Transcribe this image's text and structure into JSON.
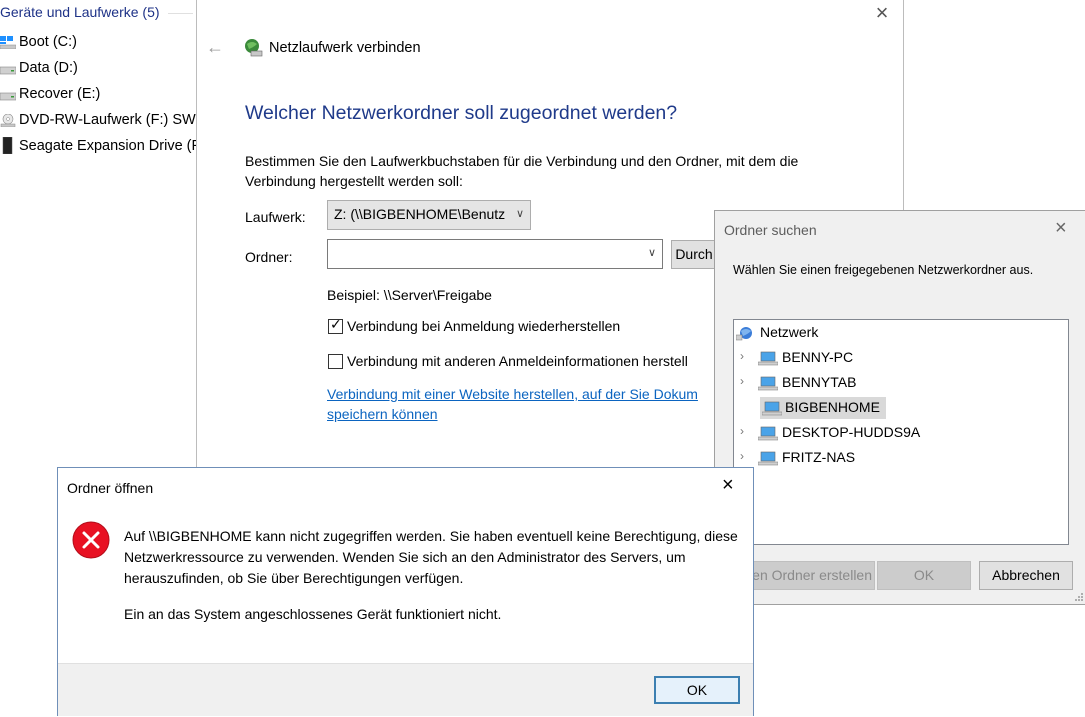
{
  "explorer": {
    "group_title": "Geräte und Laufwerke (5)",
    "drives": [
      {
        "label": "Boot (C:)",
        "icon": "windows-drive-icon"
      },
      {
        "label": "Data (D:)",
        "icon": "drive-icon"
      },
      {
        "label": "Recover (E:)",
        "icon": "drive-icon"
      },
      {
        "label": "DVD-RW-Laufwerk (F:) SW",
        "icon": "dvd-drive-icon"
      },
      {
        "label": "Seagate Expansion Drive (F",
        "icon": "external-drive-icon"
      }
    ]
  },
  "wizard": {
    "title": "Netzlaufwerk verbinden",
    "close": "×",
    "back": "←",
    "heading": "Welcher Netzwerkordner soll zugeordnet werden?",
    "description": "Bestimmen Sie den Laufwerkbuchstaben für die Verbindung und den Ordner, mit dem die Verbindung hergestellt werden soll:",
    "drive_label": "Laufwerk:",
    "drive_value": "Z: (\\\\BIGBENHOME\\Benutz",
    "folder_label": "Ordner:",
    "folder_value": "",
    "browse_button": "Durch",
    "example": "Beispiel: \\\\Server\\Freigabe",
    "reconnect_label": "Verbindung bei Anmeldung wiederherstellen",
    "reconnect_checked": true,
    "other_creds_label": "Verbindung mit anderen Anmeldeinformationen herstell",
    "other_creds_checked": false,
    "website_link_line1": "Verbindung mit einer Website herstellen, auf der Sie Dokum",
    "website_link_line2": "speichern können"
  },
  "browse": {
    "title": "Ordner suchen",
    "close": "×",
    "instruction": "Wählen Sie einen freigegebenen Netzwerkordner aus.",
    "root": "Netzwerk",
    "nodes": [
      {
        "label": "BENNY-PC",
        "selected": false
      },
      {
        "label": "BENNYTAB",
        "selected": false
      },
      {
        "label": "BIGBENHOME",
        "selected": true
      },
      {
        "label": "DESKTOP-HUDDS9A",
        "selected": false
      },
      {
        "label": "FRITZ-NAS",
        "selected": false
      }
    ],
    "new_folder_button": "en Ordner erstellen",
    "ok_button": "OK",
    "cancel_button": "Abbrechen"
  },
  "error": {
    "title": "Ordner öffnen",
    "close": "×",
    "message": "Auf \\\\BIGBENHOME kann nicht zugegriffen werden. Sie haben eventuell keine Berechtigung, diese Netzwerkressource zu verwenden. Wenden Sie sich an den Administrator des Servers, um herauszufinden, ob Sie über Berechtigungen verfügen.",
    "detail": "Ein an das System angeschlossenes Gerät funktioniert nicht.",
    "ok_button": "OK",
    "icon_color": "#e81123"
  }
}
